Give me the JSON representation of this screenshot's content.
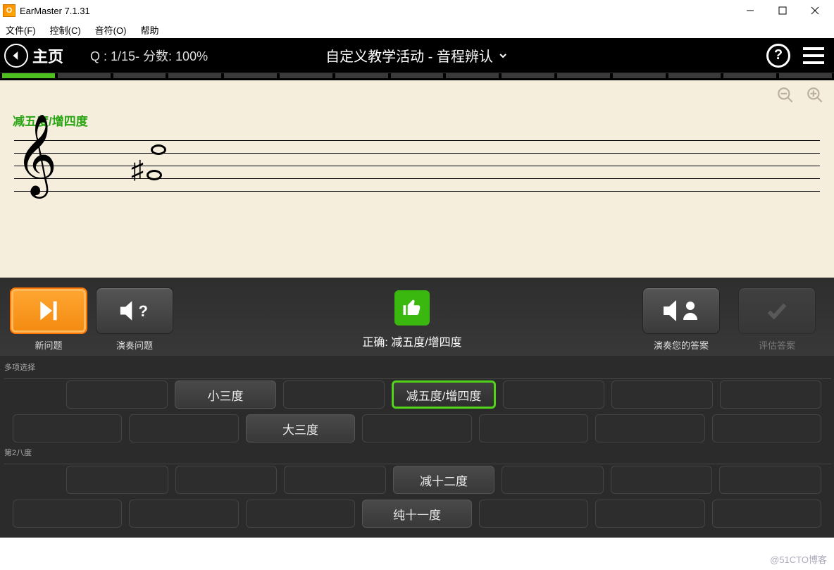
{
  "window": {
    "title": "EarMaster 7.1.31"
  },
  "menu": {
    "file": "文件(F)",
    "control": "控制(C)",
    "note": "音符(O)",
    "help": "帮助"
  },
  "appbar": {
    "home": "主页",
    "score": "Q : 1/15- 分数: 100%",
    "title": "自定义教学活动 - 音程辨认"
  },
  "progress": {
    "total": 15,
    "done": 1
  },
  "staff": {
    "answer_label": "减五度/增四度"
  },
  "panel": {
    "new_question": "新问题",
    "play_question": "演奏问题",
    "feedback_prefix": "正确: ",
    "feedback_answer": "减五度/增四度",
    "play_your_answer": "演奏您的答案",
    "evaluate": "评估答案"
  },
  "sections": {
    "multichoice": "多项选择",
    "octave2": "第2八度"
  },
  "row1": [
    "",
    "小三度",
    "",
    "减五度/增四度",
    "",
    "",
    ""
  ],
  "row1_correct_index": 3,
  "row2": [
    "",
    "",
    "大三度",
    "",
    "",
    "",
    ""
  ],
  "row3": [
    "",
    "",
    "",
    "减十二度",
    "",
    "",
    ""
  ],
  "row4": [
    "",
    "",
    "",
    "纯十一度",
    "",
    "",
    ""
  ],
  "watermark": "@51CTO博客"
}
